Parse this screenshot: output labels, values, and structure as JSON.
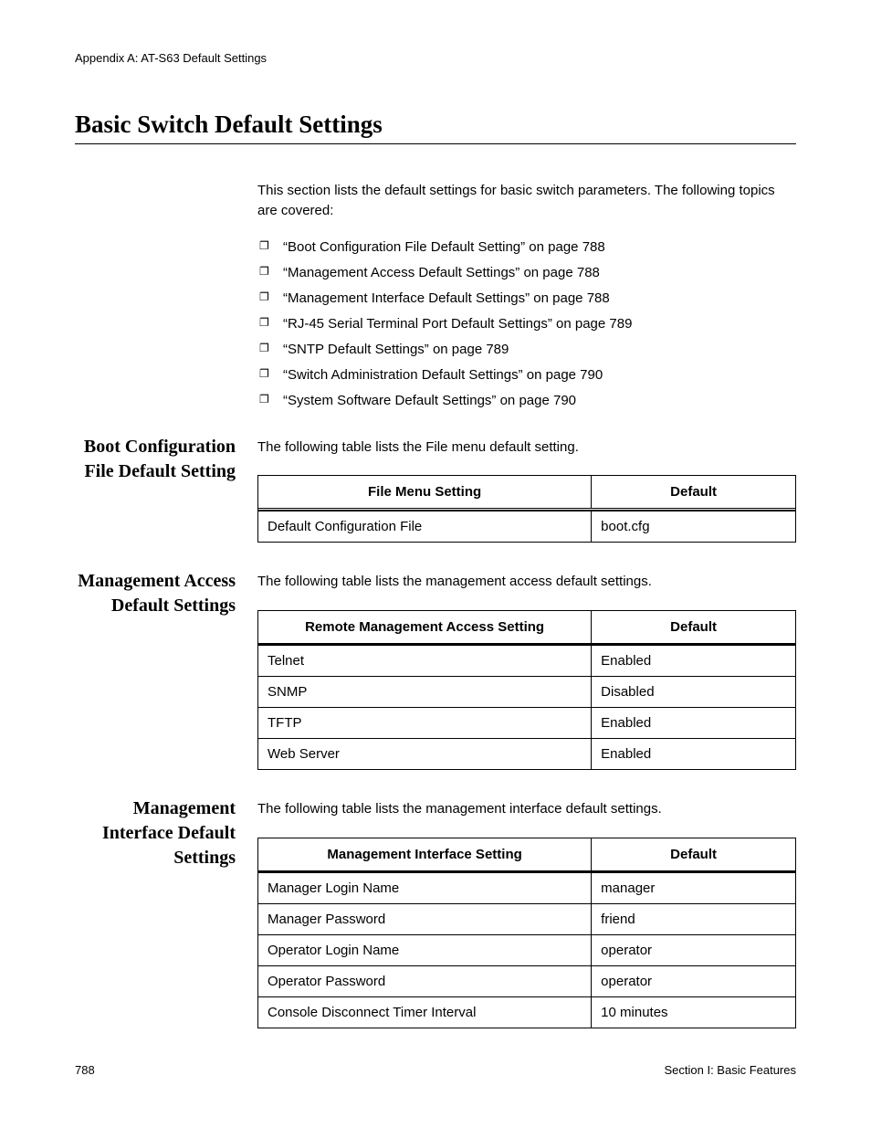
{
  "header": {
    "appendix": "Appendix A: AT-S63 Default Settings"
  },
  "title": "Basic Switch Default Settings",
  "intro": "This section lists the default settings for basic switch parameters. The following topics are covered:",
  "bullets": [
    "“Boot Configuration File Default Setting” on page 788",
    "“Management Access Default Settings” on page 788",
    "“Management Interface Default Settings” on page 788",
    "“RJ-45 Serial Terminal Port Default Settings” on page 789",
    "“SNTP Default Settings” on page 789",
    "“Switch Administration Default Settings” on page 790",
    "“System Software Default Settings” on page 790"
  ],
  "sections": {
    "boot": {
      "heading": "Boot Configuration File Default Setting",
      "intro": "The following table lists the File menu default setting.",
      "col1": "File Menu Setting",
      "col2": "Default",
      "rows": [
        {
          "setting": "Default Configuration File",
          "default": "boot.cfg"
        }
      ]
    },
    "access": {
      "heading": "Management Access Default Settings",
      "intro": "The following table lists the management access default settings.",
      "col1": "Remote Management Access Setting",
      "col2": "Default",
      "rows": [
        {
          "setting": "Telnet",
          "default": "Enabled"
        },
        {
          "setting": "SNMP",
          "default": "Disabled"
        },
        {
          "setting": "TFTP",
          "default": "Enabled"
        },
        {
          "setting": "Web Server",
          "default": "Enabled"
        }
      ]
    },
    "interface": {
      "heading": "Management Interface Default Settings",
      "intro": "The following table lists the management interface default settings.",
      "col1": "Management Interface Setting",
      "col2": "Default",
      "rows": [
        {
          "setting": "Manager Login Name",
          "default": "manager"
        },
        {
          "setting": "Manager Password",
          "default": "friend"
        },
        {
          "setting": "Operator Login Name",
          "default": "operator"
        },
        {
          "setting": "Operator Password",
          "default": "operator"
        },
        {
          "setting": "Console Disconnect Timer Interval",
          "default": "10 minutes"
        }
      ]
    }
  },
  "footer": {
    "page": "788",
    "section": "Section I: Basic Features"
  }
}
